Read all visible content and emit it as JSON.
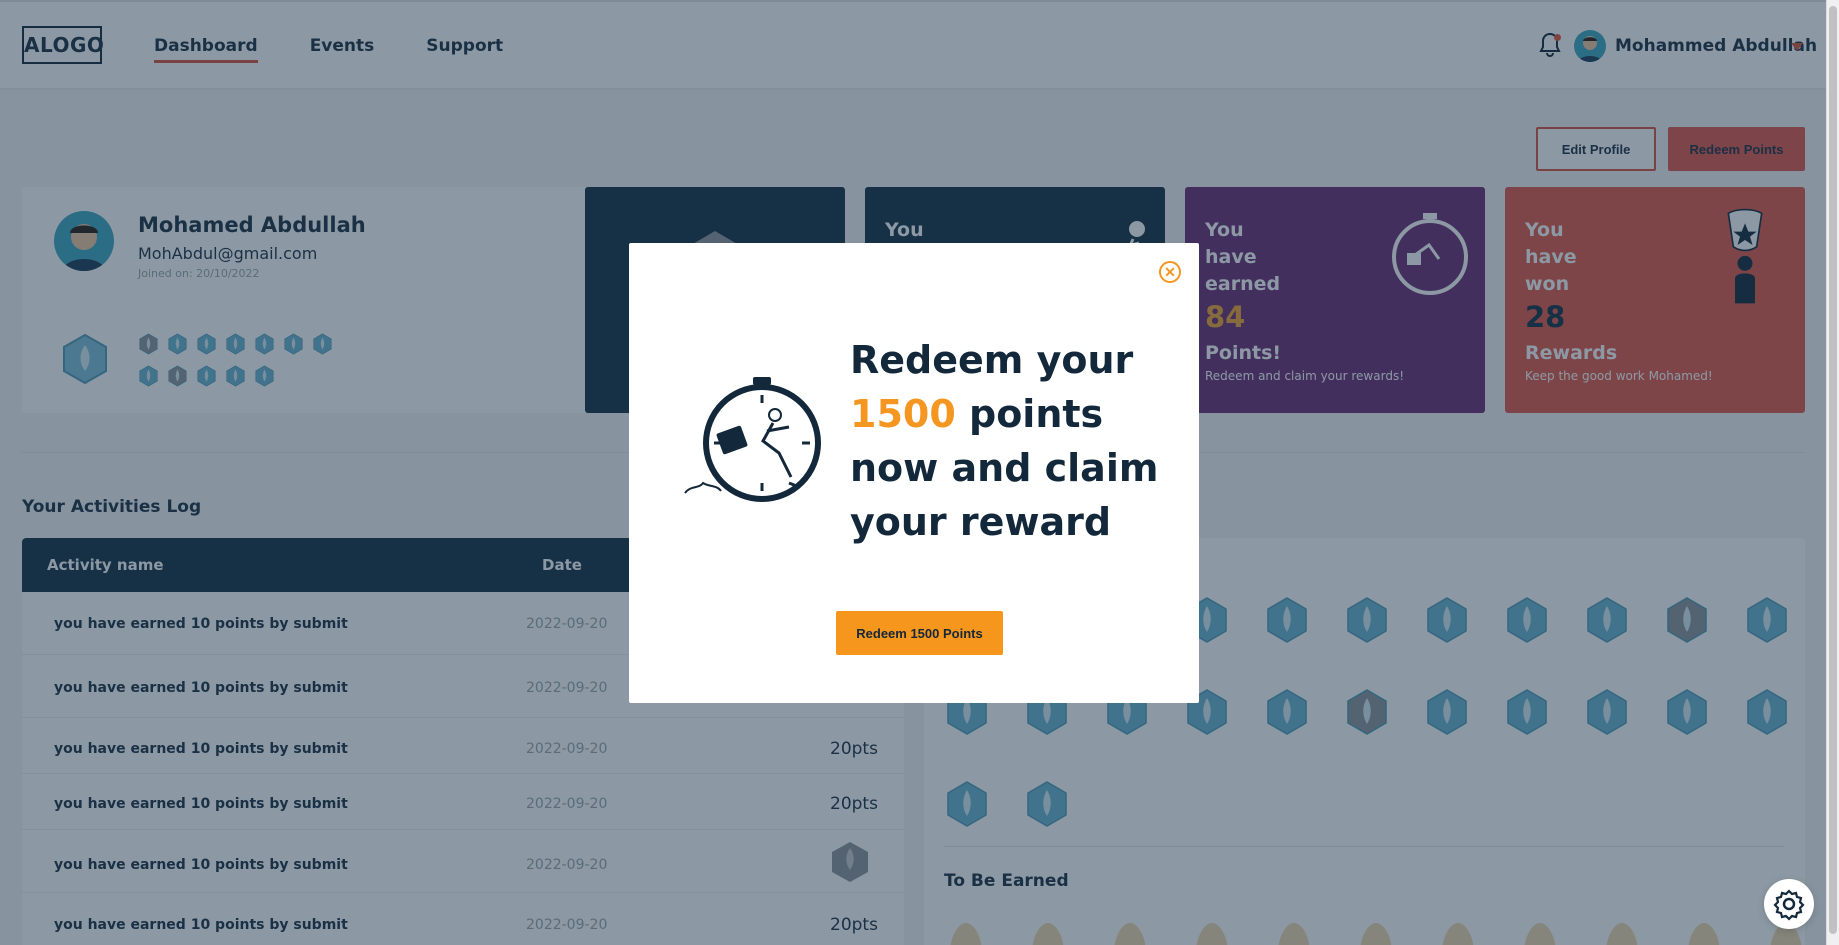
{
  "brand": {
    "logo": "ALOGO"
  },
  "nav": {
    "items": [
      {
        "label": "Dashboard"
      },
      {
        "label": "Events"
      },
      {
        "label": "Support"
      }
    ]
  },
  "user": {
    "name": "Mohammed Abdullah"
  },
  "actions": {
    "edit_profile": "Edit Profile",
    "redeem_points": "Redeem Points"
  },
  "profile": {
    "name": "Mohamed Abdullah",
    "email": "MohAbdul@gmail.com",
    "joined": "Joined on: 20/10/2022"
  },
  "cards": [
    {
      "label": "You",
      "number": "",
      "suffix": "",
      "sub": ""
    },
    {
      "label": "You have earned",
      "number": "84",
      "suffix": "Points!",
      "sub": "Redeem and claim your rewards!"
    },
    {
      "label": "You have won",
      "number": "28",
      "suffix": "Rewards",
      "sub": "Keep the good work Mohamed!"
    }
  ],
  "activities": {
    "title": "Your Activities Log",
    "columns": [
      "Activity name",
      "Date"
    ],
    "rows": [
      {
        "name": "you have earned 10 points by submit",
        "date": "2022-09-20",
        "points": ""
      },
      {
        "name": "you have earned 10 points by submit",
        "date": "2022-09-20",
        "points": ""
      },
      {
        "name": "you have earned 10 points by submit",
        "date": "2022-09-20",
        "points": "20pts"
      },
      {
        "name": "you have earned 10 points by submit",
        "date": "2022-09-20",
        "points": "20pts"
      },
      {
        "name": "you have earned 10 points by submit",
        "date": "2022-09-20",
        "points": ""
      },
      {
        "name": "you have earned 10 points by submit",
        "date": "2022-09-20",
        "points": "20pts"
      }
    ]
  },
  "badges": {
    "to_be_earned_title": "To Be Earned"
  },
  "modal": {
    "heading_before": "Redeem your ",
    "heading_accent": "1500",
    "heading_after": " points now and claim your reward",
    "button": "Redeem 1500 Points"
  },
  "colors": {
    "navy": "#132e45",
    "purple": "#6d2d75",
    "coral": "#e2594b",
    "orange": "#f4961f",
    "badge_blue": "#6ab5d0",
    "badge_grey": "#8f959a"
  },
  "icons": [
    "bell-icon",
    "chevron-down-icon",
    "close-icon",
    "gear-icon",
    "badge-icon",
    "stopwatch-illustration",
    "trophy-illustration"
  ]
}
